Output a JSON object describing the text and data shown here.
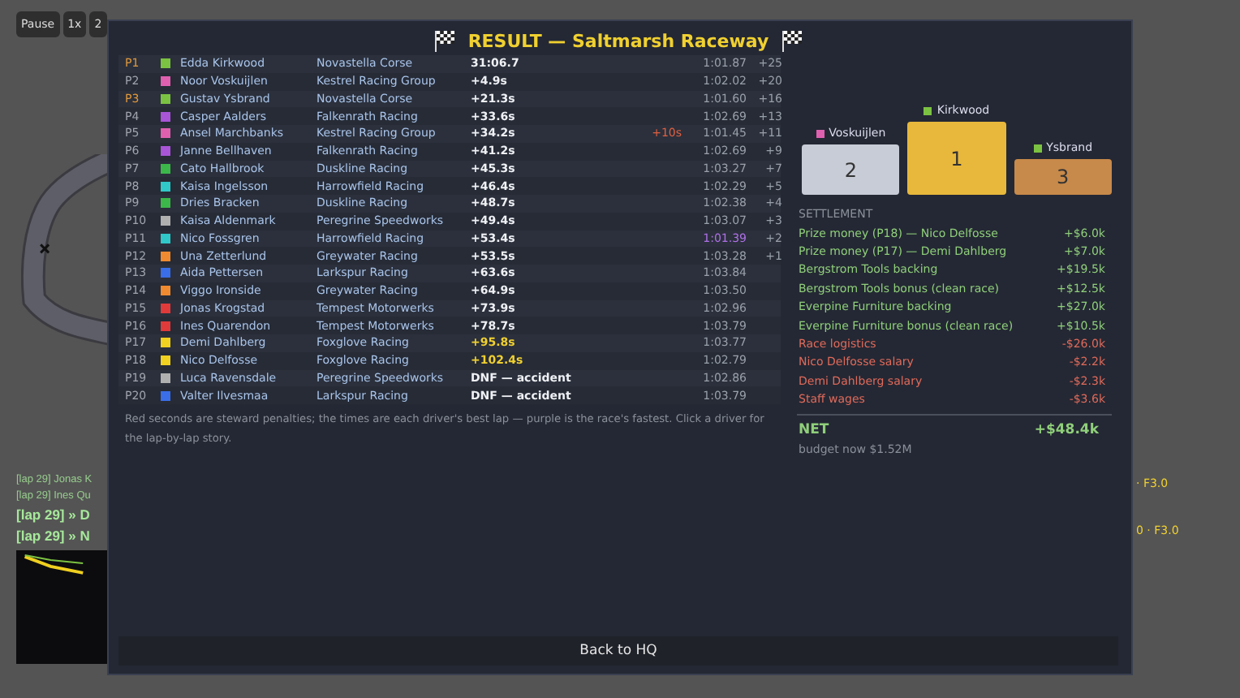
{
  "toolbar": {
    "buttons": [
      {
        "label": "Pause"
      },
      {
        "label": "1x"
      },
      {
        "label": "2"
      }
    ]
  },
  "log": [
    {
      "text": "[lap 29] Jonas K",
      "kind": "minor"
    },
    {
      "text": "[lap 29] Ines Qu",
      "kind": "minor"
    },
    {
      "text": "[lap 29] » D",
      "kind": "major"
    },
    {
      "text": "[lap 29] » N",
      "kind": "major"
    }
  ],
  "side_notes": [
    "· F3.0",
    "0 · F3.0"
  ],
  "dialog": {
    "title": "RESULT — Saltmarsh Raceway",
    "results": [
      {
        "pos": "P1",
        "highlight": true,
        "color": "#7cc242",
        "driver": "Edda Kirkwood",
        "team": "Novastella Corse",
        "gap": "31:06.7",
        "own_team": false,
        "best_lap": "1:01.87",
        "fastest": false,
        "points": "+25"
      },
      {
        "pos": "P2",
        "highlight": false,
        "color": "#e060b0",
        "driver": "Noor Voskuijlen",
        "team": "Kestrel Racing Group",
        "gap": "+4.9s",
        "own_team": false,
        "best_lap": "1:02.02",
        "fastest": false,
        "points": "+20"
      },
      {
        "pos": "P3",
        "highlight": true,
        "color": "#7cc242",
        "driver": "Gustav Ysbrand",
        "team": "Novastella Corse",
        "gap": "+21.3s",
        "own_team": false,
        "best_lap": "1:01.60",
        "fastest": false,
        "points": "+16"
      },
      {
        "pos": "P4",
        "highlight": false,
        "color": "#a855d8",
        "driver": "Casper Aalders",
        "team": "Falkenrath Racing",
        "gap": "+33.6s",
        "own_team": false,
        "best_lap": "1:02.69",
        "fastest": false,
        "points": "+13"
      },
      {
        "pos": "P5",
        "highlight": false,
        "color": "#e060b0",
        "driver": "Ansel Marchbanks",
        "team": "Kestrel Racing Group",
        "gap": "+34.2s",
        "own_team": false,
        "penalty": "+10s",
        "best_lap": "1:01.45",
        "fastest": false,
        "points": "+11"
      },
      {
        "pos": "P6",
        "highlight": false,
        "color": "#a855d8",
        "driver": "Janne Bellhaven",
        "team": "Falkenrath Racing",
        "gap": "+41.2s",
        "own_team": false,
        "best_lap": "1:02.69",
        "fastest": false,
        "points": "+9"
      },
      {
        "pos": "P7",
        "highlight": false,
        "color": "#3cb84a",
        "driver": "Cato Hallbrook",
        "team": "Duskline Racing",
        "gap": "+45.3s",
        "own_team": false,
        "best_lap": "1:03.27",
        "fastest": false,
        "points": "+7"
      },
      {
        "pos": "P8",
        "highlight": false,
        "color": "#30c8c8",
        "driver": "Kaisa Ingelsson",
        "team": "Harrowfield Racing",
        "gap": "+46.4s",
        "own_team": false,
        "best_lap": "1:02.29",
        "fastest": false,
        "points": "+5"
      },
      {
        "pos": "P9",
        "highlight": false,
        "color": "#3cb84a",
        "driver": "Dries Bracken",
        "team": "Duskline Racing",
        "gap": "+48.7s",
        "own_team": false,
        "best_lap": "1:02.38",
        "fastest": false,
        "points": "+4"
      },
      {
        "pos": "P10",
        "highlight": false,
        "color": "#b0b0b0",
        "driver": "Kaisa Aldenmark",
        "team": "Peregrine Speedworks",
        "gap": "+49.4s",
        "own_team": false,
        "best_lap": "1:03.07",
        "fastest": false,
        "points": "+3"
      },
      {
        "pos": "P11",
        "highlight": false,
        "color": "#30c8c8",
        "driver": "Nico Fossgren",
        "team": "Harrowfield Racing",
        "gap": "+53.4s",
        "own_team": false,
        "best_lap": "1:01.39",
        "fastest": true,
        "points": "+2"
      },
      {
        "pos": "P12",
        "highlight": false,
        "color": "#f08a30",
        "driver": "Una Zetterlund",
        "team": "Greywater Racing",
        "gap": "+53.5s",
        "own_team": false,
        "best_lap": "1:03.28",
        "fastest": false,
        "points": "+1"
      },
      {
        "pos": "P13",
        "highlight": false,
        "color": "#3a6ee8",
        "driver": "Aida Pettersen",
        "team": "Larkspur Racing",
        "gap": "+63.6s",
        "own_team": false,
        "best_lap": "1:03.84",
        "fastest": false
      },
      {
        "pos": "P14",
        "highlight": false,
        "color": "#f08a30",
        "driver": "Viggo Ironside",
        "team": "Greywater Racing",
        "gap": "+64.9s",
        "own_team": false,
        "best_lap": "1:03.50",
        "fastest": false
      },
      {
        "pos": "P15",
        "highlight": false,
        "color": "#e03a3a",
        "driver": "Jonas Krogstad",
        "team": "Tempest Motorwerks",
        "gap": "+73.9s",
        "own_team": false,
        "best_lap": "1:02.96",
        "fastest": false
      },
      {
        "pos": "P16",
        "highlight": false,
        "color": "#e03a3a",
        "driver": "Ines Quarendon",
        "team": "Tempest Motorwerks",
        "gap": "+78.7s",
        "own_team": false,
        "best_lap": "1:03.79",
        "fastest": false
      },
      {
        "pos": "P17",
        "highlight": false,
        "color": "#f0d020",
        "driver": "Demi Dahlberg",
        "team": "Foxglove Racing",
        "gap": "+95.8s",
        "own_team": true,
        "best_lap": "1:03.77",
        "fastest": false
      },
      {
        "pos": "P18",
        "highlight": false,
        "color": "#f0d020",
        "driver": "Nico Delfosse",
        "team": "Foxglove Racing",
        "gap": "+102.4s",
        "own_team": true,
        "best_lap": "1:02.79",
        "fastest": false
      },
      {
        "pos": "P19",
        "highlight": false,
        "color": "#b0b0b0",
        "driver": "Luca Ravensdale",
        "team": "Peregrine Speedworks",
        "gap": "DNF — accident",
        "own_team": false,
        "best_lap": "1:02.86",
        "fastest": false
      },
      {
        "pos": "P20",
        "highlight": false,
        "color": "#3a6ee8",
        "driver": "Valter Ilvesmaa",
        "team": "Larkspur Racing",
        "gap": "DNF — accident",
        "own_team": false,
        "best_lap": "1:03.79",
        "fastest": false
      }
    ],
    "footnote": "Red seconds are steward penalties; the times are each driver's best lap — purple is the race's fastest. Click a driver for the lap-by-lap story.",
    "podium": [
      {
        "place": "2",
        "kind": "silver",
        "name": "Voskuijlen",
        "color": "#e060b0"
      },
      {
        "place": "1",
        "kind": "gold",
        "name": "Kirkwood",
        "color": "#7cc242"
      },
      {
        "place": "3",
        "kind": "bronze",
        "name": "Ysbrand",
        "color": "#7cc242"
      }
    ],
    "settlement": {
      "heading": "SETTLEMENT",
      "items": [
        {
          "label": "Prize money (P18) — Nico Delfosse",
          "amount": "+$6.0k",
          "kind": "income"
        },
        {
          "label": "Prize money (P17) — Demi Dahlberg",
          "amount": "+$7.0k",
          "kind": "income"
        },
        {
          "label": "Bergstrom Tools backing",
          "amount": "+$19.5k",
          "kind": "income"
        },
        {
          "label": "Bergstrom Tools bonus (clean race)",
          "amount": "+$12.5k",
          "kind": "income"
        },
        {
          "label": "Everpine Furniture backing",
          "amount": "+$27.0k",
          "kind": "income"
        },
        {
          "label": "Everpine Furniture bonus (clean race)",
          "amount": "+$10.5k",
          "kind": "income"
        },
        {
          "label": "Race logistics",
          "amount": "-$26.0k",
          "kind": "expense"
        },
        {
          "label": "Nico Delfosse salary",
          "amount": "-$2.2k",
          "kind": "expense"
        },
        {
          "label": "Demi Dahlberg salary",
          "amount": "-$2.3k",
          "kind": "expense"
        },
        {
          "label": "Staff wages",
          "amount": "-$3.6k",
          "kind": "expense"
        }
      ],
      "net_label": "NET",
      "net": "+$48.4k",
      "budget": "budget now $1.52M"
    },
    "button": "Back to HQ"
  }
}
